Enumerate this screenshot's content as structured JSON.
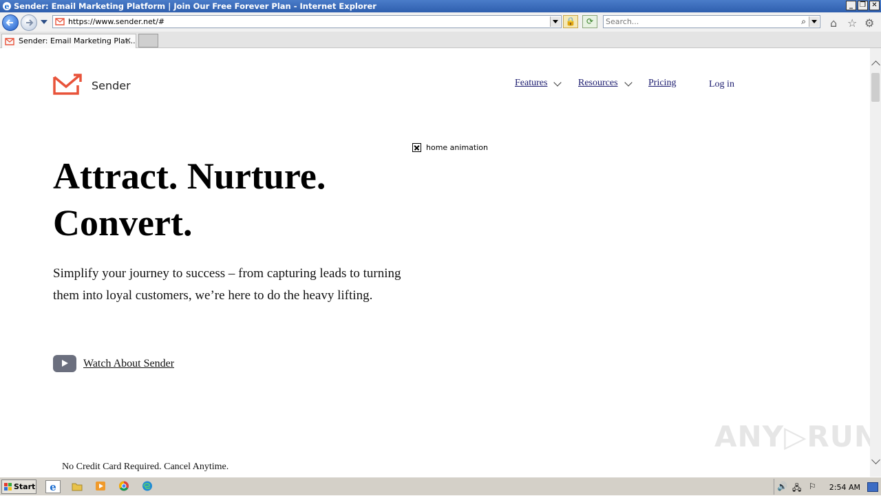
{
  "window": {
    "title": "Sender: Email Marketing Platform | Join Our Free Forever Plan - Internet Explorer"
  },
  "toolbar": {
    "url": "https://www.sender.net/#",
    "search_placeholder": "Search..."
  },
  "tabs": [
    {
      "label": "Sender: Email Marketing Plat..."
    }
  ],
  "site": {
    "brand": "Sender",
    "nav": {
      "features": "Features",
      "resources": "Resources",
      "pricing": "Pricing",
      "login": "Log in"
    },
    "animation_alt": "home animation",
    "hero": {
      "line1": "Attract. Nurture.",
      "line2": "Convert."
    },
    "subtitle": "Simplify your journey to success – from capturing leads to turning them into loyal customers, we’re here to do the heavy lifting.",
    "watch_label": "Watch About Sender",
    "no_credit_card": "No Credit Card Required. Cancel Anytime.",
    "brand_color": "#E8533A"
  },
  "watermark": "ANY▷RUN",
  "taskbar": {
    "start_label": "Start",
    "clock": "2:54 AM"
  }
}
